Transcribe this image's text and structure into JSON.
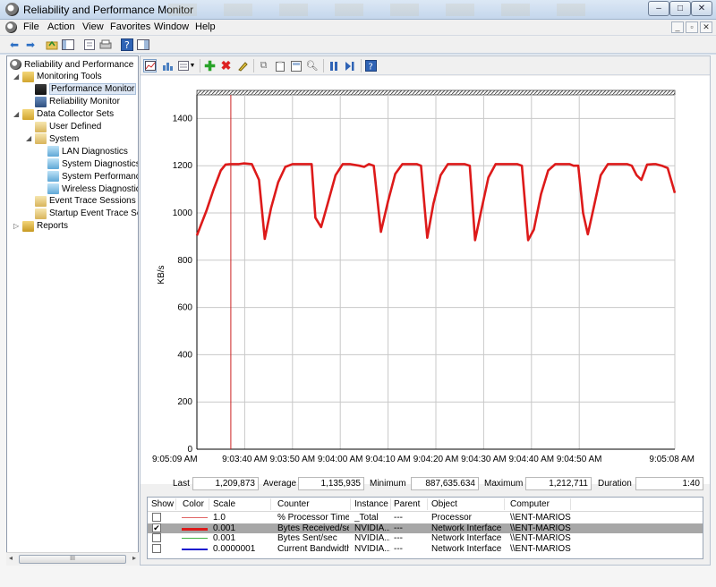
{
  "window": {
    "title": "Reliability and Performance Monitor",
    "min": "–",
    "max": "□",
    "close": "✕"
  },
  "menu": [
    "File",
    "Action",
    "View",
    "Favorites",
    "Window",
    "Help"
  ],
  "mdi_controls": [
    "_",
    "▫",
    "✕"
  ],
  "tree": [
    {
      "label": "Reliability and Performance",
      "indent": 0,
      "icon": "monitor-gauge-icon"
    },
    {
      "label": "Monitoring Tools",
      "indent": 1,
      "icon": "folder-icon",
      "expanded": true
    },
    {
      "label": "Performance Monitor",
      "indent": 2,
      "icon": "performance-chart-icon",
      "selected": true
    },
    {
      "label": "Reliability Monitor",
      "indent": 2,
      "icon": "reliability-chart-icon"
    },
    {
      "label": "Data Collector Sets",
      "indent": 1,
      "icon": "folder-icon",
      "expanded": true
    },
    {
      "label": "User Defined",
      "indent": 2,
      "icon": "collector-set-icon"
    },
    {
      "label": "System",
      "indent": 2,
      "icon": "collector-set-icon",
      "expanded": true
    },
    {
      "label": "LAN Diagnostics",
      "indent": 3,
      "icon": "collector-icon"
    },
    {
      "label": "System Diagnostics",
      "indent": 3,
      "icon": "collector-icon"
    },
    {
      "label": "System Performanc",
      "indent": 3,
      "icon": "collector-icon"
    },
    {
      "label": "Wireless Diagnostic",
      "indent": 3,
      "icon": "collector-icon"
    },
    {
      "label": "Event Trace Sessions",
      "indent": 2,
      "icon": "trace-icon"
    },
    {
      "label": "Startup Event Trace Ses",
      "indent": 2,
      "icon": "trace-icon"
    },
    {
      "label": "Reports",
      "indent": 1,
      "icon": "reports-icon",
      "expanded": false
    }
  ],
  "tree_scroll_label": "III",
  "stats": {
    "last_label": "Last",
    "last": "1,209,873",
    "average_label": "Average",
    "average": "1,135,935",
    "minimum_label": "Minimum",
    "minimum": "887,635.634",
    "maximum_label": "Maximum",
    "maximum": "1,212,711",
    "duration_label": "Duration",
    "duration": "1:40"
  },
  "legend": {
    "headers": [
      "Show",
      "Color",
      "Scale",
      "Counter",
      "Instance",
      "Parent",
      "Object",
      "Computer"
    ],
    "rows": [
      {
        "show": false,
        "color": "#e06666",
        "width": 1,
        "scale": "1.0",
        "counter": "% Processor Time",
        "instance": "_Total",
        "parent": "---",
        "object": "Processor",
        "computer": "\\\\ENT-MARIOS",
        "selected": false
      },
      {
        "show": true,
        "color": "#dd1a1a",
        "width": 3,
        "scale": "0.001",
        "counter": "Bytes Received/sec",
        "instance": "NVIDIA...",
        "parent": "---",
        "object": "Network Interface",
        "computer": "\\\\ENT-MARIOS",
        "selected": true
      },
      {
        "show": false,
        "color": "#3fb33f",
        "width": 1,
        "scale": "0.001",
        "counter": "Bytes Sent/sec",
        "instance": "NVIDIA...",
        "parent": "---",
        "object": "Network Interface",
        "computer": "\\\\ENT-MARIOS",
        "selected": false
      },
      {
        "show": false,
        "color": "#1c1ccf",
        "width": 2,
        "scale": "0.0000001",
        "counter": "Current Bandwidth",
        "instance": "NVIDIA...",
        "parent": "---",
        "object": "Network Interface",
        "computer": "\\\\ENT-MARIOS",
        "selected": false
      }
    ]
  },
  "chart_data": {
    "type": "line",
    "ylabel": "KB/s",
    "ylim": [
      0,
      1500
    ],
    "yticks": [
      0,
      200,
      400,
      600,
      800,
      1000,
      1200,
      1400
    ],
    "xlim": [
      0,
      100
    ],
    "xtick_positions": [
      0,
      10,
      20,
      30,
      40,
      50,
      60,
      70,
      80,
      100
    ],
    "xtick_labels": [
      "9:05:09 AM",
      "",
      "9:03:40 AM",
      "9:03:50 AM",
      "9:04:00 AM",
      "9:04:10 AM",
      "9:04:20 AM",
      "9:04:30 AM",
      "9:04:40 AM",
      "9:04:50 AM",
      "9:05:08 AM"
    ],
    "current_time_marker": 7.1,
    "grid": true,
    "series": [
      {
        "color": "#dd1a1a",
        "values": [
          [
            0,
            905
          ],
          [
            2,
            1010
          ],
          [
            3.5,
            1100
          ],
          [
            5,
            1180
          ],
          [
            6,
            1205
          ],
          [
            7,
            1207
          ],
          [
            8.8,
            1207
          ],
          [
            9.8,
            1210
          ],
          [
            11.5,
            1207
          ],
          [
            13,
            1140
          ],
          [
            14.2,
            890
          ],
          [
            15.5,
            1020
          ],
          [
            17,
            1130
          ],
          [
            18.5,
            1195
          ],
          [
            20,
            1207
          ],
          [
            24,
            1207
          ],
          [
            24.8,
            980
          ],
          [
            26,
            940
          ],
          [
            27.5,
            1050
          ],
          [
            29,
            1160
          ],
          [
            30.5,
            1207
          ],
          [
            32,
            1207
          ],
          [
            34,
            1200
          ],
          [
            35,
            1195
          ],
          [
            36,
            1207
          ],
          [
            37,
            1200
          ],
          [
            38.5,
            920
          ],
          [
            40,
            1050
          ],
          [
            41.5,
            1165
          ],
          [
            43,
            1207
          ],
          [
            46,
            1207
          ],
          [
            46.9,
            1200
          ],
          [
            48.2,
            895
          ],
          [
            49.5,
            1040
          ],
          [
            51,
            1160
          ],
          [
            52.5,
            1207
          ],
          [
            56,
            1207
          ],
          [
            57.1,
            1200
          ],
          [
            58.2,
            885
          ],
          [
            59.5,
            1010
          ],
          [
            61,
            1150
          ],
          [
            62.5,
            1207
          ],
          [
            67,
            1207
          ],
          [
            68,
            1200
          ],
          [
            69.3,
            885
          ],
          [
            70.5,
            930
          ],
          [
            72,
            1080
          ],
          [
            73.5,
            1180
          ],
          [
            75,
            1207
          ],
          [
            78,
            1207
          ],
          [
            78.8,
            1200
          ],
          [
            79.8,
            1200
          ],
          [
            80.8,
            1000
          ],
          [
            81.8,
            910
          ],
          [
            83,
            1020
          ],
          [
            84.5,
            1160
          ],
          [
            86,
            1207
          ],
          [
            90,
            1207
          ],
          [
            91,
            1200
          ],
          [
            92,
            1160
          ],
          [
            93,
            1140
          ],
          [
            94.2,
            1205
          ],
          [
            95.5,
            1207
          ],
          [
            96,
            1207
          ],
          [
            97.3,
            1200
          ],
          [
            98.5,
            1190
          ],
          [
            100,
            1085
          ]
        ]
      }
    ]
  }
}
